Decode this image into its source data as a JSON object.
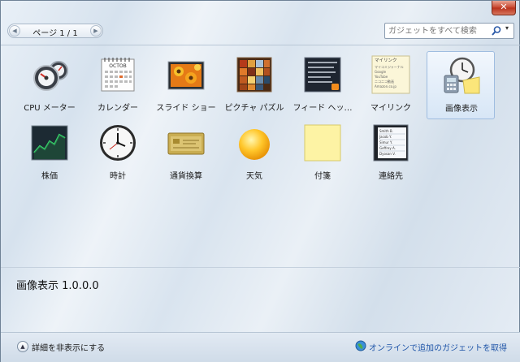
{
  "window": {
    "close_glyph": "✕"
  },
  "pager": {
    "label": "ページ 1 / 1",
    "prev_glyph": "◀",
    "next_glyph": "▶"
  },
  "search": {
    "placeholder": "ガジェットをすべて検索",
    "value": "",
    "dropdown_glyph": "▾"
  },
  "gadgets": [
    {
      "label": "CPU メーター",
      "icon": "cpu-meter-icon"
    },
    {
      "label": "カレンダー",
      "icon": "calendar-icon"
    },
    {
      "label": "スライド ショー",
      "icon": "slideshow-icon"
    },
    {
      "label": "ピクチャ パズル",
      "icon": "picture-puzzle-icon"
    },
    {
      "label": "フィード ヘッ…",
      "icon": "feed-headlines-icon"
    },
    {
      "label": "マイリンク",
      "icon": "my-links-icon"
    },
    {
      "label": "画像表示",
      "icon": "image-display-icon",
      "selected": true
    },
    {
      "label": "株価",
      "icon": "stocks-icon"
    },
    {
      "label": "時計",
      "icon": "clock-icon"
    },
    {
      "label": "通貨換算",
      "icon": "currency-icon"
    },
    {
      "label": "天気",
      "icon": "weather-icon"
    },
    {
      "label": "付箋",
      "icon": "sticky-note-icon"
    },
    {
      "label": "連絡先",
      "icon": "contacts-icon"
    }
  ],
  "calendar_icon": {
    "month": "OCTOB"
  },
  "mylinks_icon": {
    "title": "マイリンク",
    "lines": [
      "マイコミジャーナル",
      "Google",
      "YouTube",
      "ニコニコ動画",
      "Amazon.co.jp"
    ]
  },
  "contacts_icon": {
    "lines": [
      "Smith B.",
      "Jacob Y.",
      "Simur Y.",
      "Geffrey A.",
      "Dyosan V."
    ]
  },
  "details": {
    "title": "画像表示 1.0.0.0"
  },
  "bottom": {
    "toggle_glyph": "▲",
    "toggle_label": "詳細を非表示にする",
    "online_link": "オンラインで追加のガジェットを取得"
  },
  "colors": {
    "link": "#1f55a8",
    "selection_border": "#9fbde0",
    "close_button": "#c7442c"
  }
}
